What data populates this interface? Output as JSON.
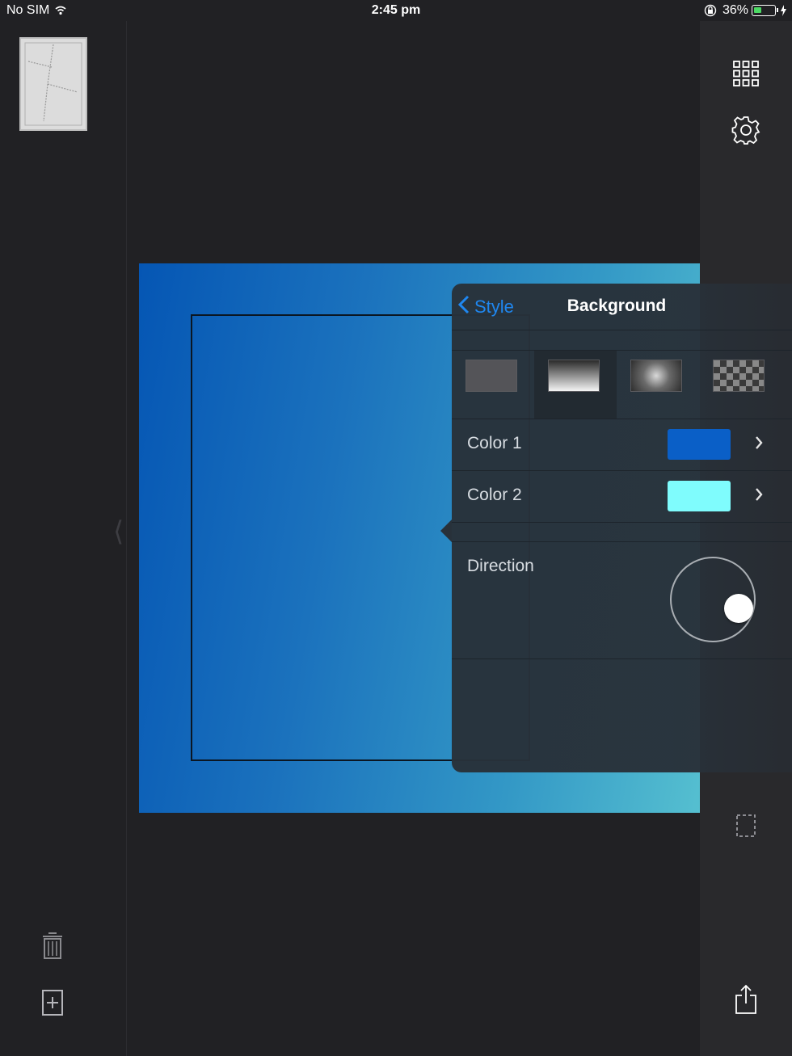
{
  "status_bar": {
    "carrier": "No SIM",
    "time": "2:45 pm",
    "battery_percent": "36%",
    "battery_level": 0.36
  },
  "left_sidebar": {
    "icons": [
      "page-thumbnail",
      "trash-icon",
      "add-page-icon"
    ]
  },
  "canvas": {
    "background": {
      "type": "linear-gradient",
      "color1": "#0556b4",
      "color2": "#7ffcfd"
    }
  },
  "right_sidebar": {
    "icons": [
      "grid-icon",
      "gear-icon",
      "dashed-frame-icon",
      "share-icon"
    ]
  },
  "popover": {
    "back_label": "Style",
    "title": "Background",
    "background_types": [
      {
        "name": "solid",
        "selected": false
      },
      {
        "name": "linear-gradient",
        "selected": true
      },
      {
        "name": "radial-gradient",
        "selected": false
      },
      {
        "name": "pattern",
        "selected": false
      }
    ],
    "color1": {
      "label": "Color 1",
      "value": "#0a5fc7"
    },
    "color2": {
      "label": "Color 2",
      "value": "#7ffcfd"
    },
    "direction": {
      "label": "Direction"
    }
  },
  "colors": {
    "accent": "#1f87f0",
    "app_background": "#212124"
  }
}
